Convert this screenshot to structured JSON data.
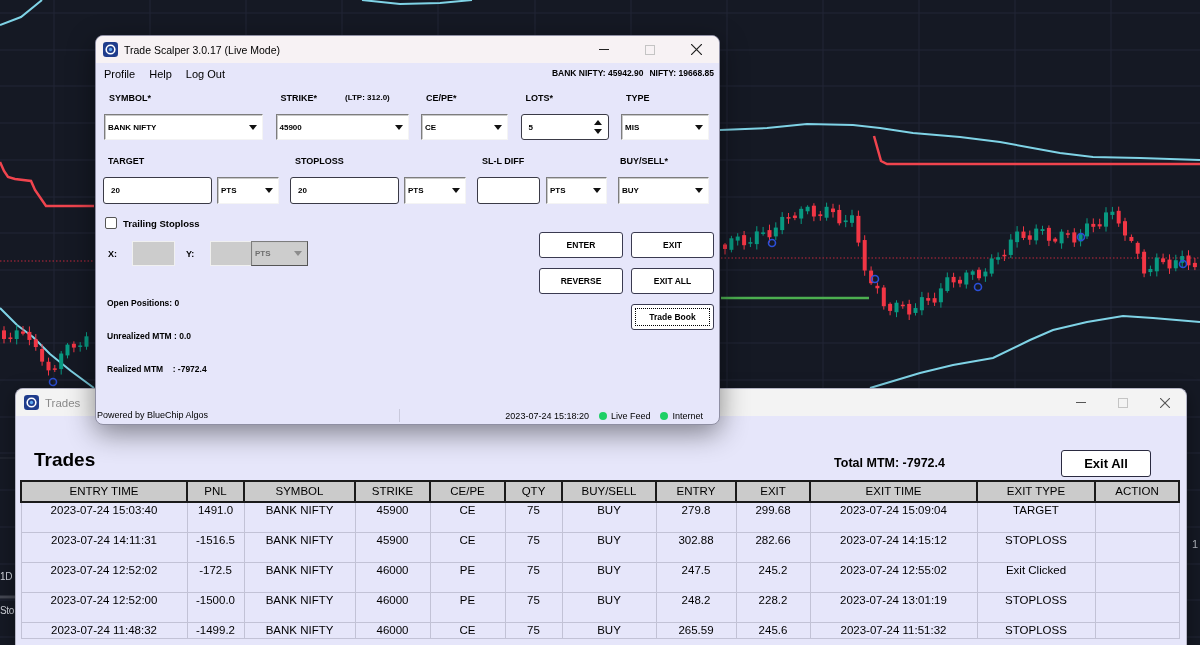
{
  "chart": {
    "left_labels": [
      "1D",
      "Sto"
    ],
    "right_label": "1"
  },
  "scalper": {
    "title": "Trade Scalper 3.0.17 (Live Mode)",
    "menu": [
      "Profile",
      "Help",
      "Log Out"
    ],
    "quotes": [
      "BANK NIFTY: 45942.90",
      "NIFTY: 19668.85"
    ],
    "row1": [
      {
        "label": "SYMBOL*",
        "kind": "dropdown",
        "value": "BANK NIFTY"
      },
      {
        "label": "STRIKE*",
        "note": "(LTP: 312.0)",
        "kind": "dropdown",
        "value": "45900"
      },
      {
        "label": "CE/PE*",
        "kind": "dropdown",
        "value": "CE"
      },
      {
        "label": "LOTS*",
        "kind": "spin",
        "value": "5"
      },
      {
        "label": "TYPE",
        "kind": "dropdown",
        "value": "MIS"
      }
    ],
    "row2": [
      {
        "label": "TARGET",
        "kind": "entry",
        "value": "20",
        "unit": "PTS"
      },
      {
        "label": "STOPLOSS",
        "kind": "entry",
        "value": "20",
        "unit": "PTS"
      },
      {
        "label": "SL-L DIFF",
        "kind": "entry",
        "unit": "PTS"
      },
      {
        "label": "BUY/SELL*",
        "kind": "dropdown",
        "value": "BUY"
      }
    ],
    "trailing": {
      "label": "Trailing Stoploss",
      "checked": false,
      "offsets": [
        {
          "label": "X:",
          "disabled": true
        },
        {
          "label": "Y:",
          "disabled": true
        }
      ],
      "unit": {
        "value": "PTS",
        "disabled": true
      }
    },
    "buttons": [
      {
        "label": "ENTER",
        "focused": false
      },
      {
        "label": "EXIT",
        "focused": false
      },
      {
        "label": "REVERSE",
        "focused": false
      },
      {
        "label": "EXIT ALL",
        "focused": false
      },
      {
        "label": "Trade Book",
        "focused": true
      }
    ],
    "stats": [
      "Open Positions: 0",
      "Unrealized MTM : 0.0",
      "Realized MTM    : -7972.4"
    ],
    "status": {
      "credit": "Powered by BlueChip Algos",
      "timestamp": "2023-07-24 15:18:20",
      "indicators": [
        {
          "label": "Live Feed",
          "on": true
        },
        {
          "label": "Internet",
          "on": true
        }
      ]
    }
  },
  "trades": {
    "title": "Trades",
    "heading": "Trades",
    "total": "Total MTM: -7972.4",
    "exit_all": "Exit All",
    "columns": [
      "ENTRY TIME",
      "PNL",
      "SYMBOL",
      "STRIKE",
      "CE/PE",
      "QTY",
      "BUY/SELL",
      "ENTRY",
      "EXIT",
      "EXIT TIME",
      "EXIT TYPE",
      "ACTION"
    ],
    "rows": [
      [
        "2023-07-24 15:03:40",
        "1491.0",
        "BANK NIFTY",
        "45900",
        "CE",
        "75",
        "BUY",
        "279.8",
        "299.68",
        "2023-07-24 15:09:04",
        "TARGET"
      ],
      [
        "2023-07-24 14:11:31",
        "-1516.5",
        "BANK NIFTY",
        "45900",
        "CE",
        "75",
        "BUY",
        "302.88",
        "282.66",
        "2023-07-24 14:15:12",
        "STOPLOSS"
      ],
      [
        "2023-07-24 12:52:02",
        "-172.5",
        "BANK NIFTY",
        "46000",
        "PE",
        "75",
        "BUY",
        "247.5",
        "245.2",
        "2023-07-24 12:55:02",
        "Exit Clicked"
      ],
      [
        "2023-07-24 12:52:00",
        "-1500.0",
        "BANK NIFTY",
        "46000",
        "PE",
        "75",
        "BUY",
        "248.2",
        "228.2",
        "2023-07-24 13:01:19",
        "STOPLOSS"
      ],
      [
        "2023-07-24 11:48:32",
        "-1499.2",
        "BANK NIFTY",
        "46000",
        "CE",
        "75",
        "BUY",
        "265.59",
        "245.6",
        "2023-07-24 11:51:32",
        "STOPLOSS"
      ]
    ]
  }
}
